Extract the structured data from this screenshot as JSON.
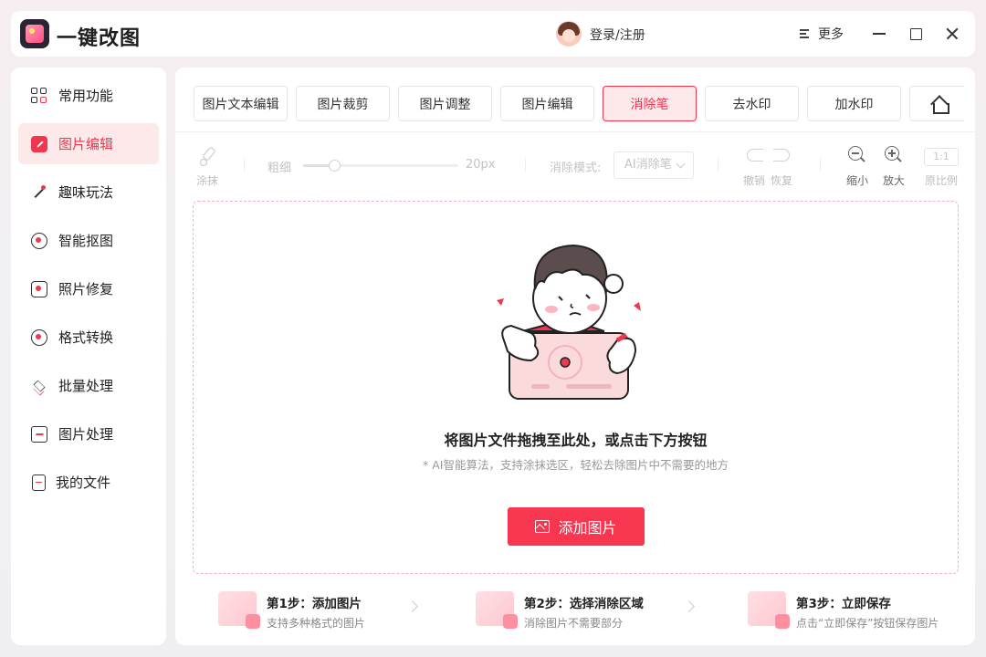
{
  "app": {
    "title": "一键改图"
  },
  "header": {
    "login_label": "登录/注册",
    "more_label": "更多"
  },
  "sidebar": {
    "items": [
      {
        "label": "常用功能",
        "icon": "grid-icon",
        "active": false
      },
      {
        "label": "图片编辑",
        "icon": "edit-icon",
        "active": true
      },
      {
        "label": "趣味玩法",
        "icon": "magic-icon",
        "active": false
      },
      {
        "label": "智能抠图",
        "icon": "cutout-icon",
        "active": false
      },
      {
        "label": "照片修复",
        "icon": "repair-icon",
        "active": false
      },
      {
        "label": "格式转换",
        "icon": "convert-icon",
        "active": false
      },
      {
        "label": "批量处理",
        "icon": "layers-icon",
        "active": false
      },
      {
        "label": "图片处理",
        "icon": "picture-icon",
        "active": false
      },
      {
        "label": "我的文件",
        "icon": "file-icon",
        "active": false
      }
    ]
  },
  "tabs": [
    {
      "label": "图片文本编辑",
      "active": false
    },
    {
      "label": "图片裁剪",
      "active": false
    },
    {
      "label": "图片调整",
      "active": false
    },
    {
      "label": "图片编辑",
      "active": false
    },
    {
      "label": "消除笔",
      "active": true
    },
    {
      "label": "去水印",
      "active": false
    },
    {
      "label": "加水印",
      "active": false
    }
  ],
  "toolbar": {
    "smear_label": "涂抹",
    "thickness_label": "粗细",
    "thickness_value": "20px",
    "thickness_fraction": 0.2,
    "mode_label": "消除模式:",
    "mode_value": "AI消除笔",
    "undo_label": "撤销",
    "redo_label": "恢复",
    "zoom_out_label": "缩小",
    "zoom_in_label": "放大",
    "ratio_box": "1:1",
    "original_ratio_label": "原比例"
  },
  "dropzone": {
    "title": "将图片文件拖拽至此处，或点击下方按钮",
    "subtitle": "* AI智能算法，支持涂抹选区，轻松去除图片中不需要的地方",
    "add_button": "添加图片"
  },
  "steps": [
    {
      "title": "第1步：添加图片",
      "desc": "支持多种格式的图片"
    },
    {
      "title": "第2步：选择消除区域",
      "desc": "消除图片不需要部分"
    },
    {
      "title": "第3步：立即保存",
      "desc": "点击“立即保存”按钮保存图片"
    }
  ],
  "colors": {
    "accent": "#f7364f",
    "accent_light": "#fde8ea"
  }
}
